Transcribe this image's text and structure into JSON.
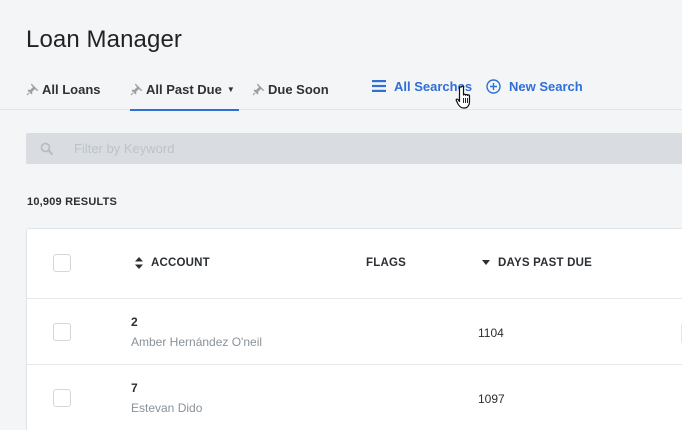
{
  "page": {
    "title": "Loan Manager"
  },
  "tabs": [
    {
      "label": "All Loans"
    },
    {
      "label": "All Past Due",
      "active": true
    },
    {
      "label": "Due Soon"
    }
  ],
  "actions": {
    "all_searches": "All Searches",
    "new_search": "New Search"
  },
  "search": {
    "placeholder": "Filter by Keyword",
    "value": ""
  },
  "results": {
    "label": "10,909 RESULTS"
  },
  "table": {
    "columns": {
      "account": "ACCOUNT",
      "flags": "FLAGS",
      "days_past_due": "DAYS PAST DUE"
    },
    "sort": {
      "column": "days_past_due",
      "direction": "descending"
    },
    "rows": [
      {
        "account": "2",
        "name": "Amber Hernández O'neil",
        "days_past_due": "1104"
      },
      {
        "account": "7",
        "name": "Estevan Dido",
        "days_past_due": "1097"
      }
    ]
  },
  "colors": {
    "accent": "#2f6fd6",
    "page_bg": "#f4f5f6",
    "search_bg": "#d9dde1",
    "text": "#2b2f33",
    "muted_text": "#8a9299"
  },
  "icons": {
    "pin": "pin-icon",
    "caret": "caret-down-icon",
    "list": "list-icon",
    "add": "plus-circle-icon",
    "search": "search-icon",
    "sort": "sort-icon",
    "cursor": "hand-pointer-cursor"
  }
}
